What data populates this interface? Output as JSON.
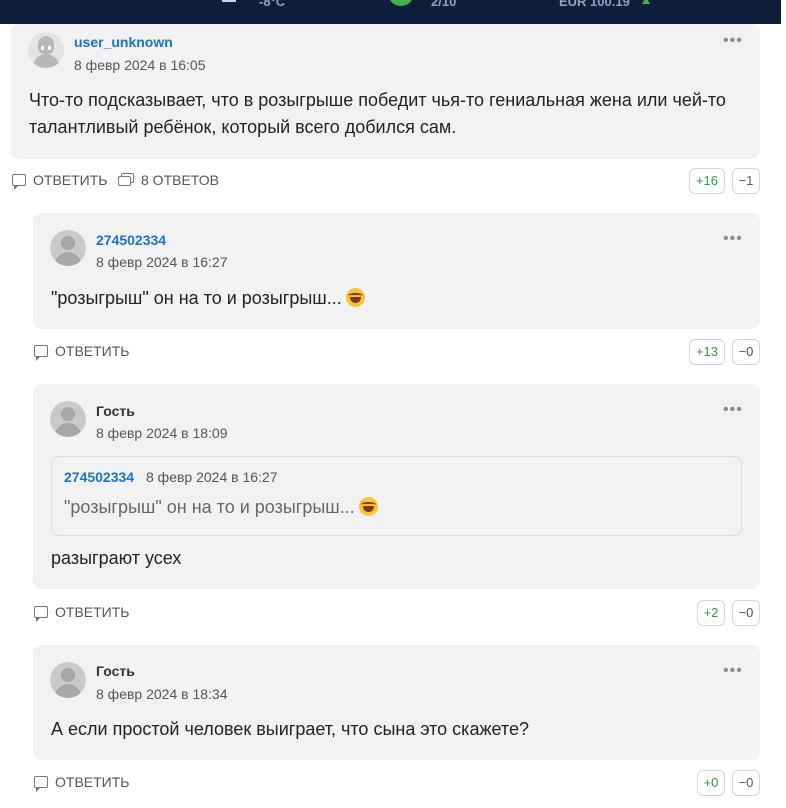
{
  "topbar": {
    "weather": "-8°C",
    "traffic": "2/10",
    "currency": "EUR 100.19",
    "status_color": "#4caf50"
  },
  "comments": [
    {
      "author": "user_unknown",
      "date": "8 февр 2024 в 16:05",
      "text": "Что-то подсказывает, что в розыгрыше победит чья-то гениальная жена или чей-то талантливый ребёнок, который всего добился сам.",
      "reply_label": "ОТВЕТИТЬ",
      "replies_label": "8 ОТВЕТОВ",
      "plus": "+16",
      "minus": "−1"
    },
    {
      "author": "274502334",
      "date": "8 февр 2024 в 16:27",
      "text": "\"розыгрыш\" он на то и розыгрыш...",
      "reply_label": "ОТВЕТИТЬ",
      "plus": "+13",
      "minus": "−0"
    },
    {
      "author": "Гость",
      "date": "8 февр 2024 в 18:09",
      "quote": {
        "author": "274502334",
        "date": "8 февр 2024 в 16:27",
        "text": "\"розыгрыш\" он на то и розыгрыш..."
      },
      "text": "разыграют усех",
      "reply_label": "ОТВЕТИТЬ",
      "plus": "+2",
      "minus": "−0"
    },
    {
      "author": "Гость",
      "date": "8 февр 2024 в 18:34",
      "text": "А если простой человек выиграет, что сына это скажете?",
      "reply_label": "ОТВЕТИТЬ",
      "plus": "+0",
      "minus": "−0"
    }
  ],
  "icons": {
    "menu": "more-horizontal-icon",
    "reply": "comment-bubble-icon",
    "replies": "comments-icon",
    "emoji": "laughing-tears-emoji-icon"
  }
}
